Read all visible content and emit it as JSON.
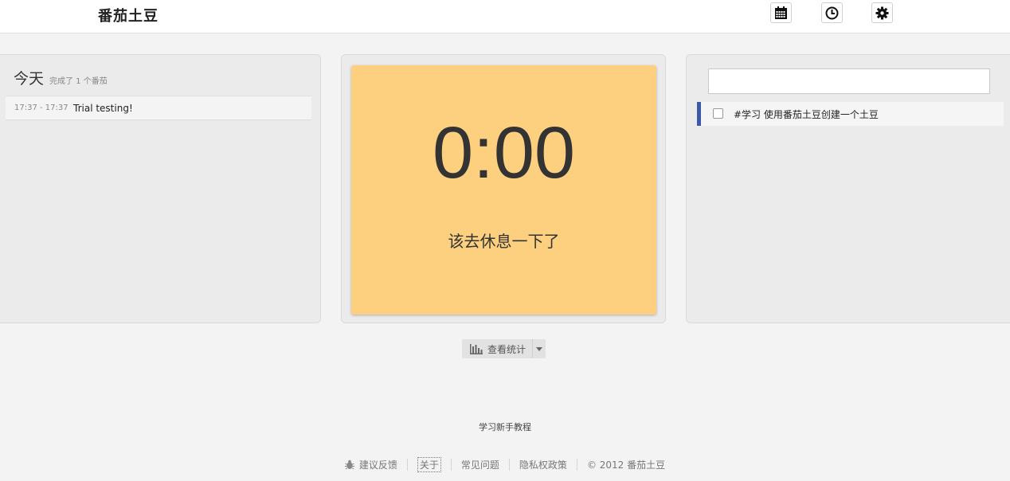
{
  "header": {
    "brand": "番茄土豆",
    "icons": [
      "calendar-icon",
      "clock-icon",
      "gear-icon"
    ]
  },
  "today": {
    "title": "今天",
    "subtitle": "完成了 1 个番茄",
    "entries": [
      {
        "time": "17:37 - 17:37",
        "text": "Trial testing!"
      }
    ]
  },
  "timer": {
    "value": "0:00",
    "message": "该去休息一下了",
    "card_color": "#fdd080"
  },
  "todo": {
    "input_value": "",
    "input_placeholder": "",
    "items": [
      {
        "text": "#学习 使用番茄土豆创建一个土豆",
        "checked": false
      }
    ],
    "accent_color": "#3d5aa8"
  },
  "stats": {
    "label": "查看统计"
  },
  "tutorial": {
    "label": "学习新手教程"
  },
  "footer": {
    "feedback": "建议反馈",
    "about": "关于",
    "faq": "常见问题",
    "privacy": "隐私权政策",
    "copyright": "© 2012 番茄土豆"
  }
}
